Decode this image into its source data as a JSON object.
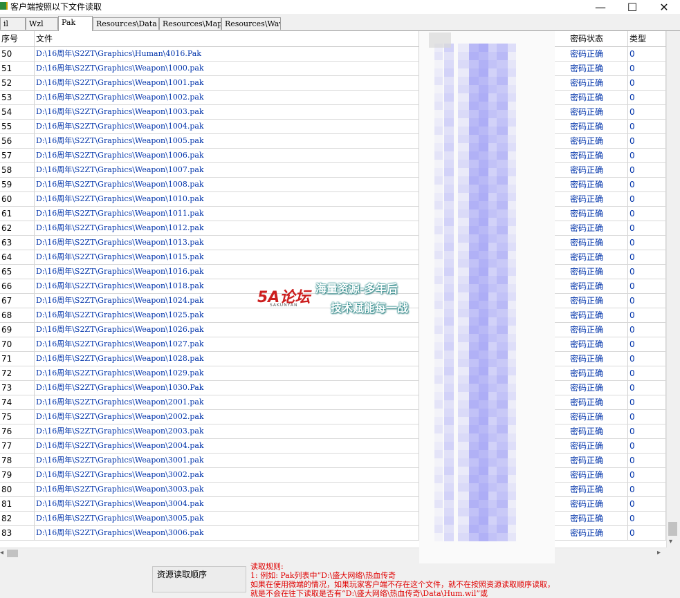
{
  "window": {
    "title": "客户端按照以下文件读取",
    "minimize_glyph": "—",
    "maximize_glyph": "☐",
    "close_glyph": "✕"
  },
  "tabs": [
    {
      "label": "il",
      "active": false
    },
    {
      "label": "Wzl",
      "active": false
    },
    {
      "label": "Pak",
      "active": true
    },
    {
      "label": "Resources\\Data",
      "active": false
    },
    {
      "label": "Resources\\Map",
      "active": false
    },
    {
      "label": "Resources\\Wav",
      "active": false
    }
  ],
  "table": {
    "headers": {
      "no": "序号",
      "file": "文件",
      "status": "密码状态",
      "type": "类型"
    },
    "rows": [
      {
        "no": "50",
        "file": "D:\\16周年\\S2ZT\\Graphics\\Human\\4016.Pak",
        "status": "密码正确",
        "type": "0"
      },
      {
        "no": "51",
        "file": "D:\\16周年\\S2ZT\\Graphics\\Weapon\\1000.pak",
        "status": "密码正确",
        "type": "0"
      },
      {
        "no": "52",
        "file": "D:\\16周年\\S2ZT\\Graphics\\Weapon\\1001.pak",
        "status": "密码正确",
        "type": "0"
      },
      {
        "no": "53",
        "file": "D:\\16周年\\S2ZT\\Graphics\\Weapon\\1002.pak",
        "status": "密码正确",
        "type": "0"
      },
      {
        "no": "54",
        "file": "D:\\16周年\\S2ZT\\Graphics\\Weapon\\1003.pak",
        "status": "密码正确",
        "type": "0"
      },
      {
        "no": "55",
        "file": "D:\\16周年\\S2ZT\\Graphics\\Weapon\\1004.pak",
        "status": "密码正确",
        "type": "0"
      },
      {
        "no": "56",
        "file": "D:\\16周年\\S2ZT\\Graphics\\Weapon\\1005.pak",
        "status": "密码正确",
        "type": "0"
      },
      {
        "no": "57",
        "file": "D:\\16周年\\S2ZT\\Graphics\\Weapon\\1006.pak",
        "status": "密码正确",
        "type": "0"
      },
      {
        "no": "58",
        "file": "D:\\16周年\\S2ZT\\Graphics\\Weapon\\1007.pak",
        "status": "密码正确",
        "type": "0"
      },
      {
        "no": "59",
        "file": "D:\\16周年\\S2ZT\\Graphics\\Weapon\\1008.pak",
        "status": "密码正确",
        "type": "0"
      },
      {
        "no": "60",
        "file": "D:\\16周年\\S2ZT\\Graphics\\Weapon\\1010.pak",
        "status": "密码正确",
        "type": "0"
      },
      {
        "no": "61",
        "file": "D:\\16周年\\S2ZT\\Graphics\\Weapon\\1011.pak",
        "status": "密码正确",
        "type": "0"
      },
      {
        "no": "62",
        "file": "D:\\16周年\\S2ZT\\Graphics\\Weapon\\1012.pak",
        "status": "密码正确",
        "type": "0"
      },
      {
        "no": "63",
        "file": "D:\\16周年\\S2ZT\\Graphics\\Weapon\\1013.pak",
        "status": "密码正确",
        "type": "0"
      },
      {
        "no": "64",
        "file": "D:\\16周年\\S2ZT\\Graphics\\Weapon\\1015.pak",
        "status": "密码正确",
        "type": "0"
      },
      {
        "no": "65",
        "file": "D:\\16周年\\S2ZT\\Graphics\\Weapon\\1016.pak",
        "status": "密码正确",
        "type": "0"
      },
      {
        "no": "66",
        "file": "D:\\16周年\\S2ZT\\Graphics\\Weapon\\1018.pak",
        "status": "密码正确",
        "type": "0"
      },
      {
        "no": "67",
        "file": "D:\\16周年\\S2ZT\\Graphics\\Weapon\\1024.pak",
        "status": "密码正确",
        "type": "0"
      },
      {
        "no": "68",
        "file": "D:\\16周年\\S2ZT\\Graphics\\Weapon\\1025.pak",
        "status": "密码正确",
        "type": "0"
      },
      {
        "no": "69",
        "file": "D:\\16周年\\S2ZT\\Graphics\\Weapon\\1026.pak",
        "status": "密码正确",
        "type": "0"
      },
      {
        "no": "70",
        "file": "D:\\16周年\\S2ZT\\Graphics\\Weapon\\1027.pak",
        "status": "密码正确",
        "type": "0"
      },
      {
        "no": "71",
        "file": "D:\\16周年\\S2ZT\\Graphics\\Weapon\\1028.pak",
        "status": "密码正确",
        "type": "0"
      },
      {
        "no": "72",
        "file": "D:\\16周年\\S2ZT\\Graphics\\Weapon\\1029.pak",
        "status": "密码正确",
        "type": "0"
      },
      {
        "no": "73",
        "file": "D:\\16周年\\S2ZT\\Graphics\\Weapon\\1030.Pak",
        "status": "密码正确",
        "type": "0"
      },
      {
        "no": "74",
        "file": "D:\\16周年\\S2ZT\\Graphics\\Weapon\\2001.pak",
        "status": "密码正确",
        "type": "0"
      },
      {
        "no": "75",
        "file": "D:\\16周年\\S2ZT\\Graphics\\Weapon\\2002.pak",
        "status": "密码正确",
        "type": "0"
      },
      {
        "no": "76",
        "file": "D:\\16周年\\S2ZT\\Graphics\\Weapon\\2003.pak",
        "status": "密码正确",
        "type": "0"
      },
      {
        "no": "77",
        "file": "D:\\16周年\\S2ZT\\Graphics\\Weapon\\2004.pak",
        "status": "密码正确",
        "type": "0"
      },
      {
        "no": "78",
        "file": "D:\\16周年\\S2ZT\\Graphics\\Weapon\\3001.pak",
        "status": "密码正确",
        "type": "0"
      },
      {
        "no": "79",
        "file": "D:\\16周年\\S2ZT\\Graphics\\Weapon\\3002.pak",
        "status": "密码正确",
        "type": "0"
      },
      {
        "no": "80",
        "file": "D:\\16周年\\S2ZT\\Graphics\\Weapon\\3003.pak",
        "status": "密码正确",
        "type": "0"
      },
      {
        "no": "81",
        "file": "D:\\16周年\\S2ZT\\Graphics\\Weapon\\3004.pak",
        "status": "密码正确",
        "type": "0"
      },
      {
        "no": "82",
        "file": "D:\\16周年\\S2ZT\\Graphics\\Weapon\\3005.pak",
        "status": "密码正确",
        "type": "0"
      },
      {
        "no": "83",
        "file": "D:\\16周年\\S2ZT\\Graphics\\Weapon\\3006.pak",
        "status": "密码正确",
        "type": "0"
      }
    ]
  },
  "bottom": {
    "order_label": "资源读取顺序",
    "rules": [
      "读取规则:",
      "1: 例如: Pak列表中“D:\\盛大网络\\热血传奇",
      "    如果在使用微端的情况，如果玩家客户端不存在这个文件，就不在按照资源读取顺序读取，",
      "    就是不会在往下读取是否有“D:\\盛大网络\\热血传奇\\Data\\Hum.wil”或"
    ]
  },
  "watermark": {
    "logo": "5A论坛",
    "logo_sub": "SAKUNYAN",
    "line1": "海量资源-多年后",
    "line2": "技术赋能每一战"
  },
  "colors": {
    "link_blue": "#0033aa",
    "rules_red": "#e00000",
    "redaction": "#a9a9f5"
  },
  "icons": {
    "window": "app-icon",
    "scroll_left": "chevron-left-icon",
    "scroll_right": "chevron-right-icon",
    "scroll_down": "chevron-down-icon"
  }
}
